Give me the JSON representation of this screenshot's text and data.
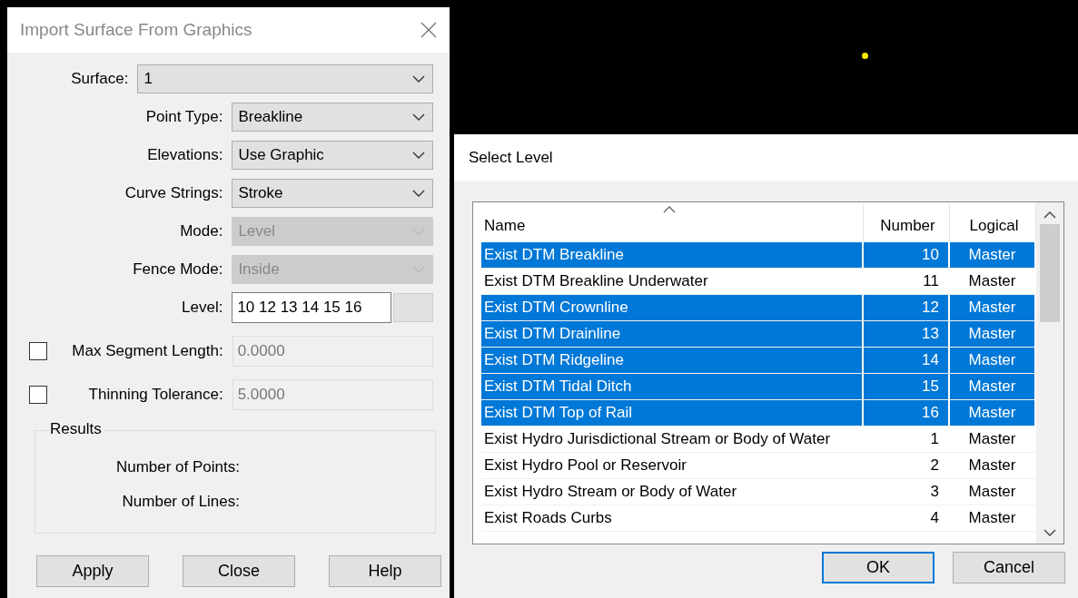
{
  "import_dialog": {
    "title": "Import Surface From Graphics",
    "surface": {
      "label": "Surface:",
      "value": "1"
    },
    "fields": [
      {
        "kind": "combo",
        "label": "Point Type:",
        "value": "Breakline",
        "disabled": false
      },
      {
        "kind": "combo",
        "label": "Elevations:",
        "value": "Use Graphic",
        "disabled": false
      },
      {
        "kind": "combo",
        "label": "Curve Strings:",
        "value": "Stroke",
        "disabled": false
      },
      {
        "kind": "combo",
        "label": "Mode:",
        "value": "Level",
        "disabled": true
      },
      {
        "kind": "combo",
        "label": "Fence Mode:",
        "value": "Inside",
        "disabled": true
      },
      {
        "kind": "level",
        "label": "Level:",
        "value": "10 12 13 14 15 16"
      },
      {
        "kind": "checked_input",
        "label": "Max Segment Length:",
        "value": "0.0000",
        "checked": false
      },
      {
        "kind": "checked_input",
        "label": "Thinning Tolerance:",
        "value": "5.0000",
        "checked": false
      }
    ],
    "results": {
      "title": "Results",
      "labels": [
        "Number of Points:",
        "Number of Lines:"
      ]
    },
    "buttons": [
      "Apply",
      "Close",
      "Help"
    ]
  },
  "select_level_dialog": {
    "title": "Select Level",
    "columns": [
      "Name",
      "Number",
      "Logical"
    ],
    "rows": [
      {
        "name": "Exist DTM Breakline",
        "number": "10",
        "logical": "Master",
        "selected": true
      },
      {
        "name": "Exist DTM Breakline Underwater",
        "number": "11",
        "logical": "Master",
        "selected": false
      },
      {
        "name": "Exist DTM Crownline",
        "number": "12",
        "logical": "Master",
        "selected": true
      },
      {
        "name": "Exist DTM Drainline",
        "number": "13",
        "logical": "Master",
        "selected": true
      },
      {
        "name": "Exist DTM Ridgeline",
        "number": "14",
        "logical": "Master",
        "selected": true
      },
      {
        "name": "Exist DTM Tidal Ditch",
        "number": "15",
        "logical": "Master",
        "selected": true
      },
      {
        "name": "Exist DTM Top of Rail",
        "number": "16",
        "logical": "Master",
        "selected": true
      },
      {
        "name": "Exist Hydro Jurisdictional Stream or Body of Water",
        "number": "1",
        "logical": "Master",
        "selected": false
      },
      {
        "name": "Exist Hydro Pool or Reservoir",
        "number": "2",
        "logical": "Master",
        "selected": false
      },
      {
        "name": "Exist Hydro Stream or Body of Water",
        "number": "3",
        "logical": "Master",
        "selected": false
      },
      {
        "name": "Exist Roads Curbs",
        "number": "4",
        "logical": "Master",
        "selected": false
      }
    ],
    "buttons": [
      {
        "label": "OK",
        "default": true
      },
      {
        "label": "Cancel",
        "default": false
      }
    ]
  }
}
